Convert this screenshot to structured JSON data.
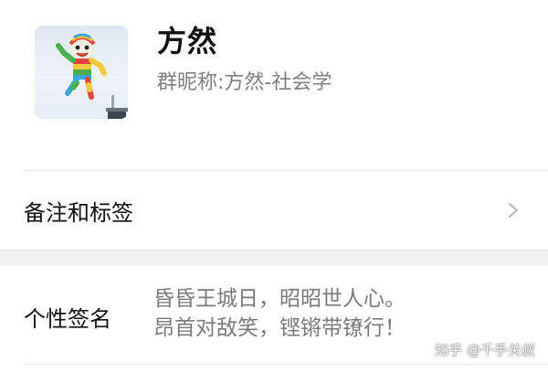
{
  "profile": {
    "name": "方然",
    "nickname_label": "群昵称:",
    "nickname_value": "方然-社会学"
  },
  "remark_row": {
    "label": "备注和标签"
  },
  "signature_row": {
    "label": "个性签名",
    "lines": [
      "昏昏王城日，昭昭世人心。",
      "昂首对敌笑，铿锵带镣行！"
    ]
  },
  "watermark": {
    "text": "知乎 @千手关叔"
  },
  "colors": {
    "background": "#ffffff",
    "separator_band": "#f0f0f0",
    "primary_text": "#111111",
    "secondary_text": "#808080"
  },
  "icons": {
    "chevron": "chevron-right-icon"
  }
}
